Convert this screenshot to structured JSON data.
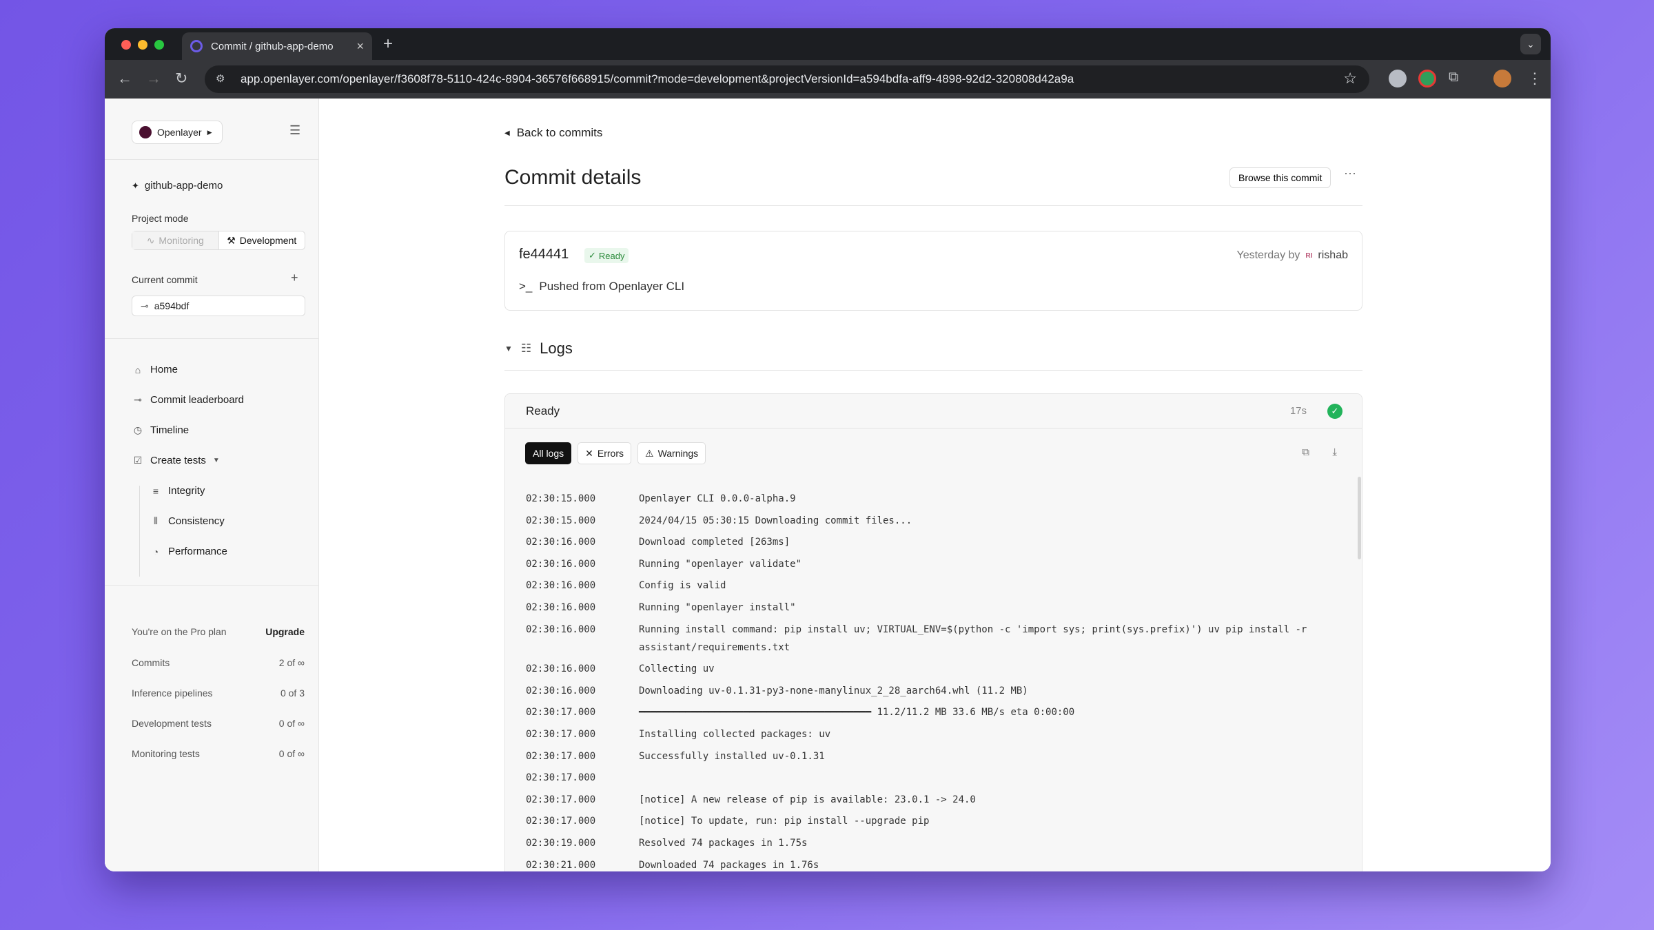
{
  "browser": {
    "tab_title": "Commit / github-app-demo",
    "url": "app.openlayer.com/openlayer/f3608f78-5110-424c-8904-36576f668915/commit?mode=development&projectVersionId=a594bdfa-aff9-4898-92d2-320808d42a9a"
  },
  "sidebar": {
    "org": "Openlayer",
    "project": "github-app-demo",
    "project_mode_label": "Project mode",
    "modes": [
      "Monitoring",
      "Development"
    ],
    "current_commit_label": "Current commit",
    "current_commit": "a594bdf",
    "nav": [
      {
        "label": "Home",
        "icon": "home-icon"
      },
      {
        "label": "Commit leaderboard",
        "icon": "commit-icon"
      },
      {
        "label": "Timeline",
        "icon": "clock-icon"
      },
      {
        "label": "Create tests",
        "icon": "checkbox-icon"
      }
    ],
    "subnav": [
      {
        "label": "Integrity",
        "icon": "list-icon"
      },
      {
        "label": "Consistency",
        "icon": "bars-icon"
      },
      {
        "label": "Performance",
        "icon": "pie-icon"
      }
    ],
    "plan_text": "You're on the Pro plan",
    "upgrade": "Upgrade",
    "usage": [
      {
        "label": "Commits",
        "value": "2 of ∞"
      },
      {
        "label": "Inference pipelines",
        "value": "0 of 3"
      },
      {
        "label": "Development tests",
        "value": "0 of ∞"
      },
      {
        "label": "Monitoring tests",
        "value": "0 of ∞"
      }
    ]
  },
  "main": {
    "back": "Back to commits",
    "title": "Commit details",
    "browse": "Browse this commit",
    "commit_hash": "fe44441",
    "status": "Ready",
    "when": "Yesterday by",
    "avatar_initials": "RI",
    "author": "rishab",
    "message": "Pushed from Openlayer CLI",
    "logs_title": "Logs",
    "log_status": "Ready",
    "log_duration": "17s",
    "filters": [
      "All logs",
      "Errors",
      "Warnings"
    ],
    "log_lines": [
      {
        "t": "02:30:15.000",
        "m": "Openlayer CLI 0.0.0-alpha.9"
      },
      {
        "t": "02:30:15.000",
        "m": "2024/04/15 05:30:15 Downloading commit files..."
      },
      {
        "t": "02:30:16.000",
        "m": "Download completed [263ms]"
      },
      {
        "t": "02:30:16.000",
        "m": "Running \"openlayer validate\""
      },
      {
        "t": "02:30:16.000",
        "m": "Config is valid"
      },
      {
        "t": "02:30:16.000",
        "m": "Running \"openlayer install\""
      },
      {
        "t": "02:30:16.000",
        "m": "Running install command: pip install uv; VIRTUAL_ENV=$(python -c 'import sys; print(sys.prefix)') uv pip install -r assistant/requirements.txt"
      },
      {
        "t": "02:30:16.000",
        "m": "Collecting uv"
      },
      {
        "t": "02:30:16.000",
        "m": "Downloading uv-0.1.31-py3-none-manylinux_2_28_aarch64.whl (11.2 MB)"
      },
      {
        "t": "02:30:17.000",
        "m": "━━━━━━━━━━━━━━━━━━━━━━━━━━━━━━━━━━━━━━━━ 11.2/11.2 MB 33.6 MB/s eta 0:00:00"
      },
      {
        "t": "02:30:17.000",
        "m": "Installing collected packages: uv"
      },
      {
        "t": "02:30:17.000",
        "m": "Successfully installed uv-0.1.31"
      },
      {
        "t": "02:30:17.000",
        "m": ""
      },
      {
        "t": "02:30:17.000",
        "m": "[notice] A new release of pip is available: 23.0.1 -> 24.0"
      },
      {
        "t": "02:30:17.000",
        "m": "[notice] To update, run: pip install --upgrade pip"
      },
      {
        "t": "02:30:19.000",
        "m": "Resolved 74 packages in 1.75s"
      },
      {
        "t": "02:30:21.000",
        "m": "Downloaded 74 packages in 1.76s"
      }
    ]
  }
}
